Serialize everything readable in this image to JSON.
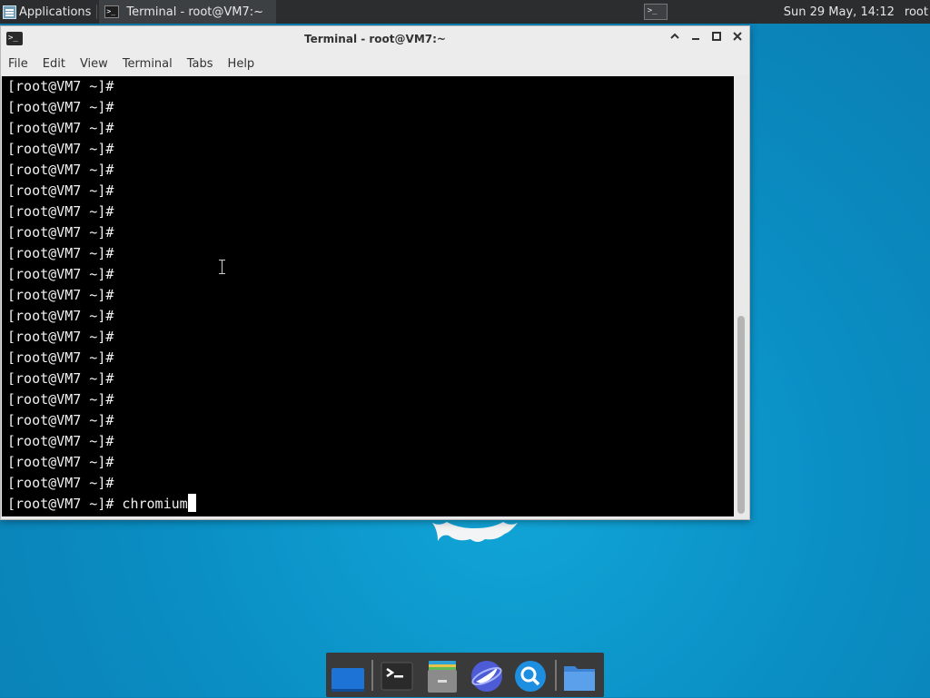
{
  "top_panel": {
    "applications_label": "Applications",
    "taskbar_item_title": "Terminal - root@VM7:~",
    "clock": "Sun 29 May, 14:12",
    "user": "root"
  },
  "window": {
    "title": "Terminal - root@VM7:~",
    "menu": [
      "File",
      "Edit",
      "View",
      "Terminal",
      "Tabs",
      "Help"
    ]
  },
  "terminal": {
    "prompt": "[root@VM7 ~]#",
    "lines": [
      "[root@VM7 ~]#",
      "[root@VM7 ~]#",
      "[root@VM7 ~]#",
      "[root@VM7 ~]#",
      "[root@VM7 ~]#",
      "[root@VM7 ~]#",
      "[root@VM7 ~]#",
      "[root@VM7 ~]#",
      "[root@VM7 ~]#",
      "[root@VM7 ~]#",
      "[root@VM7 ~]#",
      "[root@VM7 ~]#",
      "[root@VM7 ~]#",
      "[root@VM7 ~]#",
      "[root@VM7 ~]#",
      "[root@VM7 ~]#",
      "[root@VM7 ~]#",
      "[root@VM7 ~]#",
      "[root@VM7 ~]#",
      "[root@VM7 ~]#",
      "[root@VM7 ~]# chromium"
    ]
  },
  "dock": {
    "items": [
      "show-desktop-icon",
      "terminal-icon",
      "file-manager-icon",
      "web-browser-icon",
      "app-finder-icon",
      "folder-icon"
    ]
  },
  "colors": {
    "desktop": "#0a8fc4",
    "panel": "#2b2d2f",
    "terminal_bg": "#000000",
    "terminal_fg": "#f0f0f0"
  }
}
